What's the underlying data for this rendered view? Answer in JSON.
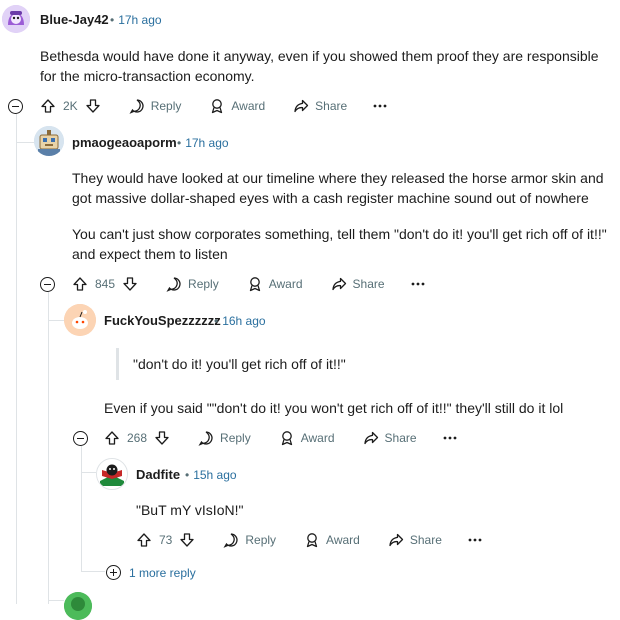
{
  "comments": [
    {
      "username": "Blue-Jay42",
      "time": "17h ago",
      "paragraphs": [
        "Bethesda would have done it anyway, even if you showed them proof they are responsible for the micro-transaction economy."
      ],
      "votes": "2K",
      "actions": {
        "reply": "Reply",
        "award": "Award",
        "share": "Share"
      }
    },
    {
      "username": "pmaogeaoaporm",
      "time": "17h ago",
      "paragraphs": [
        "They would have looked at our timeline where they released the horse armor skin and got massive dollar-shaped eyes with a cash register machine sound out of nowhere",
        "You can't just show corporates something, tell them \"don't do it! you'll get rich off of it!!\" and expect them to listen"
      ],
      "votes": "845",
      "actions": {
        "reply": "Reply",
        "award": "Award",
        "share": "Share"
      }
    },
    {
      "username": "FuckYouSpezzzzzz",
      "time": "16h ago",
      "quote": "\"don't do it! you'll get rich off of it!!\"",
      "paragraphs": [
        "Even if you said \"\"don't do it! you won't get rich off of it!!\" they'll still do it lol"
      ],
      "votes": "268",
      "actions": {
        "reply": "Reply",
        "award": "Award",
        "share": "Share"
      }
    },
    {
      "username": "Dadfite",
      "time": "15h ago",
      "paragraphs": [
        "\"BuT mY vIsIoN!\""
      ],
      "votes": "73",
      "actions": {
        "reply": "Reply",
        "award": "Award",
        "share": "Share"
      }
    }
  ],
  "more_replies": "1 more reply",
  "separator": "•",
  "colors": {
    "meta_blue": "#2a6f9e",
    "thread_line": "#dfe3e6",
    "muted": "#576f76"
  }
}
